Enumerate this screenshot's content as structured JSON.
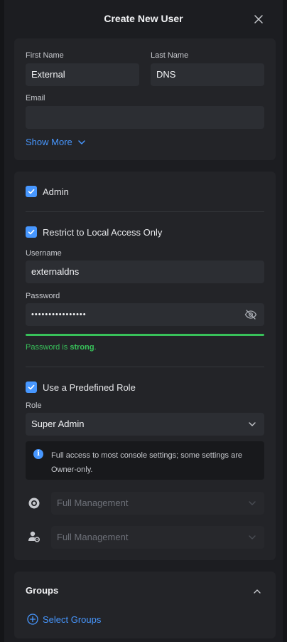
{
  "modal": {
    "title": "Create New User"
  },
  "basic": {
    "first_name_label": "First Name",
    "first_name_value": "External",
    "last_name_label": "Last Name",
    "last_name_value": "DNS",
    "email_label": "Email",
    "email_value": "",
    "show_more_label": "Show More"
  },
  "access": {
    "admin_label": "Admin",
    "admin_checked": true,
    "restrict_label": "Restrict to Local Access Only",
    "restrict_checked": true,
    "username_label": "Username",
    "username_value": "externaldns",
    "password_label": "Password",
    "password_masked": "••••••••••••••••",
    "strength_prefix": "Password is ",
    "strength_value": "strong",
    "strength_suffix": ".",
    "strength_level": 1.0,
    "predefined_label": "Use a Predefined Role",
    "predefined_checked": true,
    "role_label": "Role",
    "role_value": "Super Admin",
    "role_info": "Full access to most console settings; some settings are Owner-only.",
    "permission_1_value": "Full Management",
    "permission_2_value": "Full Management"
  },
  "groups": {
    "title": "Groups",
    "select_label": "Select Groups"
  },
  "icons": {
    "close": "close-icon",
    "chevron_down": "chevron-down-icon",
    "chevron_up": "chevron-up-icon",
    "eye_off": "eye-off-icon",
    "info": "info-icon",
    "check": "check-icon",
    "plus_circle": "plus-circle-icon",
    "network": "network-app-icon",
    "user_settings": "user-settings-icon"
  },
  "colors": {
    "accent": "#4797ff",
    "success": "#38c15a",
    "panel": "#232428",
    "background": "#1c1d21"
  }
}
